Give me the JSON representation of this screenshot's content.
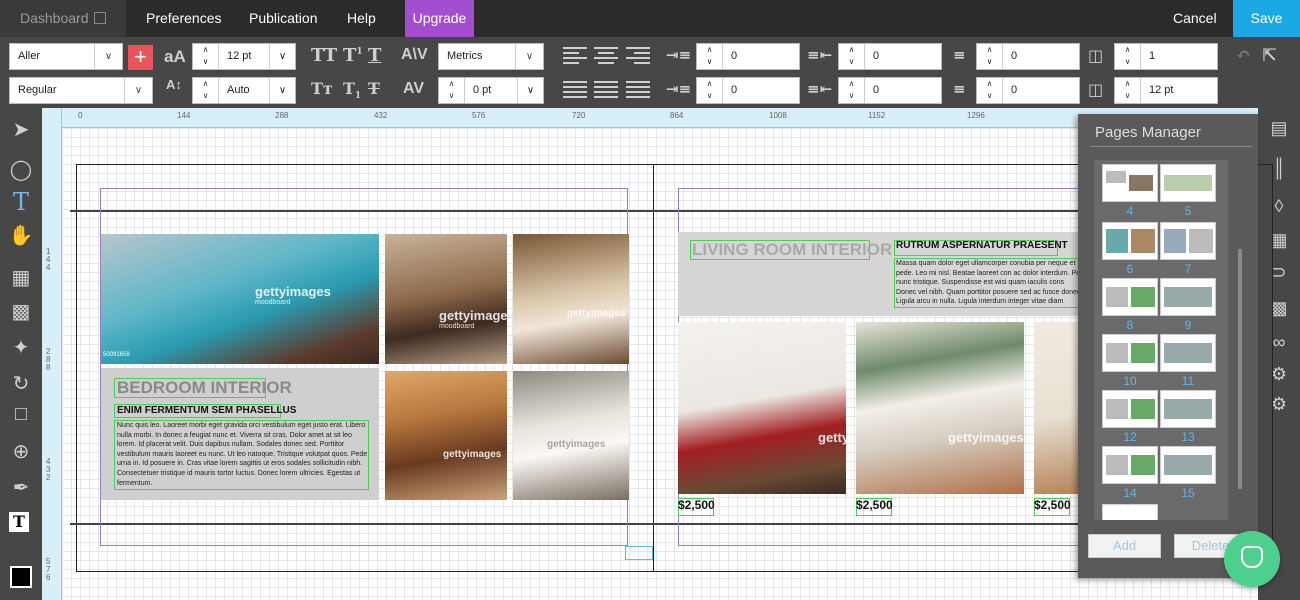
{
  "topbar": {
    "dashboard": "Dashboard",
    "menu": [
      "Preferences",
      "Publication",
      "Help"
    ],
    "upgrade": "Upgrade",
    "cancel": "Cancel",
    "save": "Save"
  },
  "toolbar": {
    "font_family": "Aller",
    "font_style": "Regular",
    "font_size": "12 pt",
    "line_height": "Auto",
    "kerning": "Metrics",
    "tracking": "0 pt",
    "indent_left": "0",
    "indent_right": "0",
    "space_before": "0",
    "space_after": "0",
    "para_space_1": "0",
    "para_space_2": "0",
    "columns": "1",
    "gutter": "12 pt"
  },
  "ruler": {
    "h_ticks": [
      "0",
      "144",
      "288",
      "432",
      "576",
      "720",
      "864",
      "1008",
      "1152",
      "1296"
    ],
    "v_ticks": [
      "1 4 4",
      "2 8 8",
      "4 3 2",
      "5 7 6"
    ]
  },
  "spread": {
    "left": {
      "heading": "BEDROOM INTERIOR",
      "subheading": "ENIM FERMENTUM SEM PHASELLUS",
      "body": "Nunc quis leo. Laoreet morbi eget gravida orci vestibulum eget justo erat. Libero nulla morbi. In donec a feugiat nunc et. Viverra sit cras. Dolor amet at sit leo lorem. Id placerat velit. Duis dapibus nullam. Sodales donec sed. Porttitor vestibulum mauris laoreet eu nunc. Ut leo natoque. Tristique volutpat quos. Pede urna in. Id posuere in. Cras vitae lorem sagittis ut eros sodales sollicitudin nibh. Consectetuer tristique id mauris tortor luctus. Donec lorem ultricies. Egestas ut fermentum.",
      "watermark": "gettyimages",
      "watermark_sub": "moodboard",
      "photo_id": "50091659"
    },
    "right": {
      "heading": "LIVING ROOM INTERIOR",
      "subheading": "RUTRUM ASPERNATUR PRAESENT",
      "body": "Massa quam dolor eget ullamcorper conubia per neque et pede. Leo mi nisl. Beatae laoreet con ac dolor interdum. Pe nunc tristique. Suspendisse est wisi quam iaculis cons Donec vel nibh. Quam porttitor posuere sed ac fusce donec. Ligula arcu in nulla. Ligula interdum integer vitae diam",
      "prices": [
        "$2,500",
        "$2,500",
        "$2,500"
      ]
    }
  },
  "pages_manager": {
    "title": "Pages Manager",
    "page_numbers": [
      "4",
      "5",
      "6",
      "7",
      "8",
      "9",
      "10",
      "11",
      "12",
      "13",
      "14",
      "15"
    ],
    "add": "Add",
    "delete": "Delete"
  },
  "icons": {
    "left_tools": [
      "select-arrow-icon",
      "shape-icon",
      "text-icon",
      "hand-icon",
      "image-icon",
      "video-icon",
      "puzzle-icon",
      "rotate-icon",
      "crop-icon",
      "zoom-icon",
      "eyedropper-icon",
      "text-color-icon",
      "fill-color-icon"
    ],
    "right_tools": [
      "pages-icon",
      "library-icon",
      "layers-icon",
      "table-icon",
      "magnet-icon",
      "image-edit-icon",
      "link-icon",
      "page-settings-icon",
      "settings-icon"
    ]
  },
  "colors": {
    "upgrade": "#a34dd1",
    "save": "#1ba9e6",
    "page_number": "#5bb8f0",
    "chat": "#4dd08e"
  }
}
